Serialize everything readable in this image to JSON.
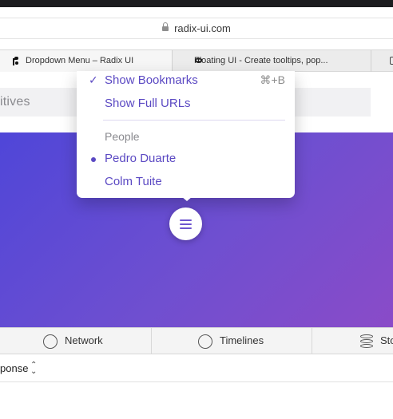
{
  "browser": {
    "address": "radix-ui.com",
    "tabs": [
      {
        "title": "Dropdown Menu – Radix UI",
        "icon": "radix-logo-icon",
        "active": true
      },
      {
        "title": "Floating UI - Create tooltips, pop...",
        "icon": "floating-ui-icon",
        "active": false
      }
    ]
  },
  "page": {
    "primitives_label": "itives"
  },
  "menu": {
    "items": [
      {
        "label": "Show Bookmarks",
        "mark": "✓",
        "shortcut": "⌘+B"
      },
      {
        "label": "Show Full URLs"
      }
    ],
    "group_label": "People",
    "people": [
      {
        "label": "Pedro Duarte",
        "selected": true
      },
      {
        "label": "Colm Tuite",
        "selected": false
      }
    ]
  },
  "devtools": {
    "tabs": [
      {
        "label": "Network",
        "icon": "network-icon"
      },
      {
        "label": "Timelines",
        "icon": "timelines-icon"
      },
      {
        "label": "Sto",
        "icon": "storage-icon"
      }
    ],
    "response_label": "ponse"
  },
  "colors": {
    "accent": "#6e56cf",
    "hero_start": "#4f46d8",
    "hero_end": "#8a4bc8"
  }
}
